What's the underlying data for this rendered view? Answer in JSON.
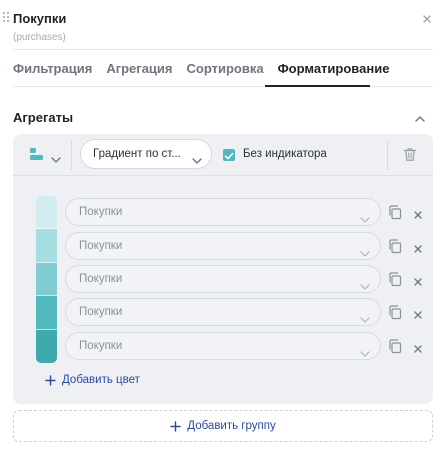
{
  "panel": {
    "title": "Покупки",
    "subtitle": "(purchases)"
  },
  "tabs": [
    {
      "label": "Фильтрация",
      "active": false
    },
    {
      "label": "Агрегация",
      "active": false
    },
    {
      "label": "Сортировка",
      "active": false
    },
    {
      "label": "Форматирование",
      "active": true
    }
  ],
  "section": {
    "title": "Агрегаты"
  },
  "group": {
    "type_icon": "bars-icon",
    "gradient_select": "Градиент по ст...",
    "no_indicator_checked": true,
    "no_indicator_label": "Без индикатора",
    "rows": [
      {
        "color": "#d2edf0",
        "field": "Покупки"
      },
      {
        "color": "#a6dde1",
        "field": "Покупки"
      },
      {
        "color": "#80ccd0",
        "field": "Покупки"
      },
      {
        "color": "#52b8be",
        "field": "Покупки"
      },
      {
        "color": "#3faaac",
        "field": "Покупки"
      }
    ],
    "add_color_label": "Добавить цвет"
  },
  "add_group_label": "Добавить группу",
  "colors": {
    "accent": "#52b8be",
    "link": "#2d4a9e"
  }
}
